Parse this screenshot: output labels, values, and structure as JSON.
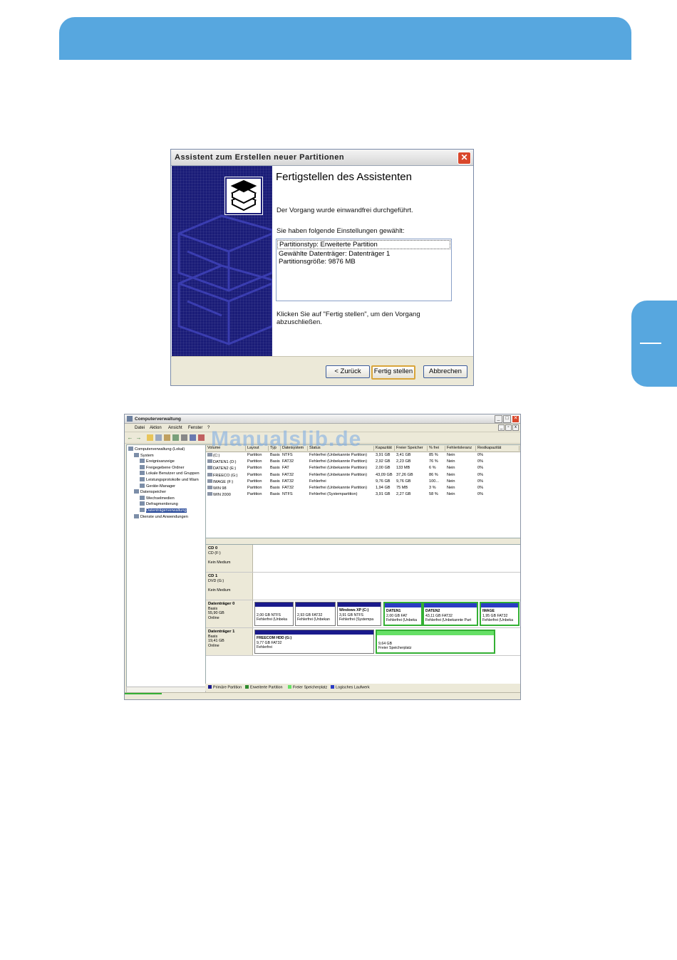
{
  "wizard": {
    "title": "Assistent zum Erstellen neuer Partitionen",
    "heading": "Fertigstellen des Assistenten",
    "status_text": "Der Vorgang wurde einwandfrei durchgeführt.",
    "settings_label": "Sie haben folgende Einstellungen gewählt:",
    "settings": [
      "Partitionstyp: Erweiterte Partition",
      "Gewählte Datenträger: Datenträger 1",
      "Partitionsgröße: 9876 MB"
    ],
    "finish_hint_line1": "Klicken Sie auf \"Fertig stellen\", um den Vorgang",
    "finish_hint_line2": "abzuschließen.",
    "back_label": "< Zurück",
    "finish_label": "Fertig stellen",
    "cancel_label": "Abbrechen",
    "close_glyph": "✕"
  },
  "compmgmt": {
    "title": "Computerverwaltung",
    "menu": [
      "Datei",
      "Aktion",
      "Ansicht",
      "Fenster",
      "?"
    ],
    "tree": [
      {
        "label": "Computerverwaltung (Lokal)",
        "level": 0
      },
      {
        "label": "System",
        "level": 1
      },
      {
        "label": "Ereignisanzeige",
        "level": 2
      },
      {
        "label": "Freigegebene Ordner",
        "level": 2
      },
      {
        "label": "Lokale Benutzer und Gruppen",
        "level": 2
      },
      {
        "label": "Leistungsprotokolle und Warn",
        "level": 2
      },
      {
        "label": "Geräte-Manager",
        "level": 2
      },
      {
        "label": "Datenspeicher",
        "level": 1
      },
      {
        "label": "Wechselmedien",
        "level": 2
      },
      {
        "label": "Defragmentierung",
        "level": 2
      },
      {
        "label": "Datenträgerverwaltung",
        "level": 2,
        "selected": true
      },
      {
        "label": "Dienste und Anwendungen",
        "level": 1
      }
    ],
    "columns": [
      "Volume",
      "Layout",
      "Typ",
      "Dateisystem",
      "Status",
      "Kapazität",
      "Freier Speicher",
      "% frei",
      "Fehlertoleranz",
      "Restkapazität"
    ],
    "volumes": [
      [
        "(C:)",
        "Partition",
        "Basis",
        "NTFS",
        "Fehlerfrei (Unbekannte Partition)",
        "3,91 GB",
        "3,41 GB",
        "85 %",
        "Nein",
        "0%"
      ],
      [
        "DATEN1 (D:)",
        "Partition",
        "Basis",
        "FAT32",
        "Fehlerfrei (Unbekannte Partition)",
        "2,92 GB",
        "2,23 GB",
        "76 %",
        "Nein",
        "0%"
      ],
      [
        "DATEN2 (E:)",
        "Partition",
        "Basis",
        "FAT",
        "Fehlerfrei (Unbekannte Partition)",
        "2,00 GB",
        "133 MB",
        "6 %",
        "Nein",
        "0%"
      ],
      [
        "FREECO (G:)",
        "Partition",
        "Basis",
        "FAT32",
        "Fehlerfrei (Unbekannte Partition)",
        "43,09 GB",
        "37,26 GB",
        "86 %",
        "Nein",
        "0%"
      ],
      [
        "IMAGE (F:)",
        "Partition",
        "Basis",
        "FAT32",
        "Fehlerfrei",
        "9,76 GB",
        "9,76 GB",
        "100...",
        "Nein",
        "0%"
      ],
      [
        "WIN 98",
        "Partition",
        "Basis",
        "FAT32",
        "Fehlerfrei (Unbekannte Partition)",
        "1,94 GB",
        "75 MB",
        "3 %",
        "Nein",
        "0%"
      ],
      [
        "WIN 2000",
        "Partition",
        "Basis",
        "NTFS",
        "Fehlerfrei (Systempartition)",
        "3,91 GB",
        "2,27 GB",
        "58 %",
        "Nein",
        "0%"
      ]
    ],
    "drives": [
      {
        "name": "CD 0",
        "line1": "CD (F:)",
        "line2": "",
        "line3": "Kein Medium"
      },
      {
        "name": "CD 1",
        "line1": "DVD (G:)",
        "line2": "",
        "line3": "Kein Medium"
      }
    ],
    "disk0": {
      "name": "Datenträger 0",
      "type": "Basis",
      "size": "55,90 GB",
      "state": "Online",
      "parts": [
        {
          "title": "",
          "size": "2,00 GB NTFS",
          "status": "Fehlerfrei (Unbeka"
        },
        {
          "title": "",
          "size": "2,93 GB FAT32",
          "status": "Fehlerfrei (Unbekan"
        },
        {
          "title": "Windows XP (C:)",
          "size": "3,91 GB NTFS",
          "status": "Fehlerfrei (Systempa"
        },
        {
          "title": "DATEN1",
          "size": "2,00 GB FAT",
          "status": "Fehlerfrei (Unbeka"
        },
        {
          "title": "DATEN2",
          "size": "43,11 GB FAT32",
          "status": "Fehlerfrei (Unbekannte Part"
        },
        {
          "title": "IMAGE",
          "size": "1,95 GB FAT32",
          "status": "Fehlerfrei (Unbeka"
        }
      ]
    },
    "disk1": {
      "name": "Datenträger 1",
      "type": "Basis",
      "size": "19,41 GB",
      "state": "Online",
      "parts": [
        {
          "title": "FREECOM HDD (G:)",
          "size": "9,77 GB FAT32",
          "status": "Fehlerfrei"
        },
        {
          "title": "",
          "size": "9,64 GB",
          "status": "Freier Speicherplatz"
        }
      ]
    },
    "legend": [
      "Primäre Partition",
      "Erweiterte Partition",
      "Freier Speicherplatz",
      "Logisches Laufwerk"
    ],
    "colors": {
      "primary": "#1a1a8c",
      "extended": "#2e8b2e",
      "free": "#66e066",
      "logical": "#2b3cc4"
    }
  },
  "watermark": "Manualslib.de"
}
